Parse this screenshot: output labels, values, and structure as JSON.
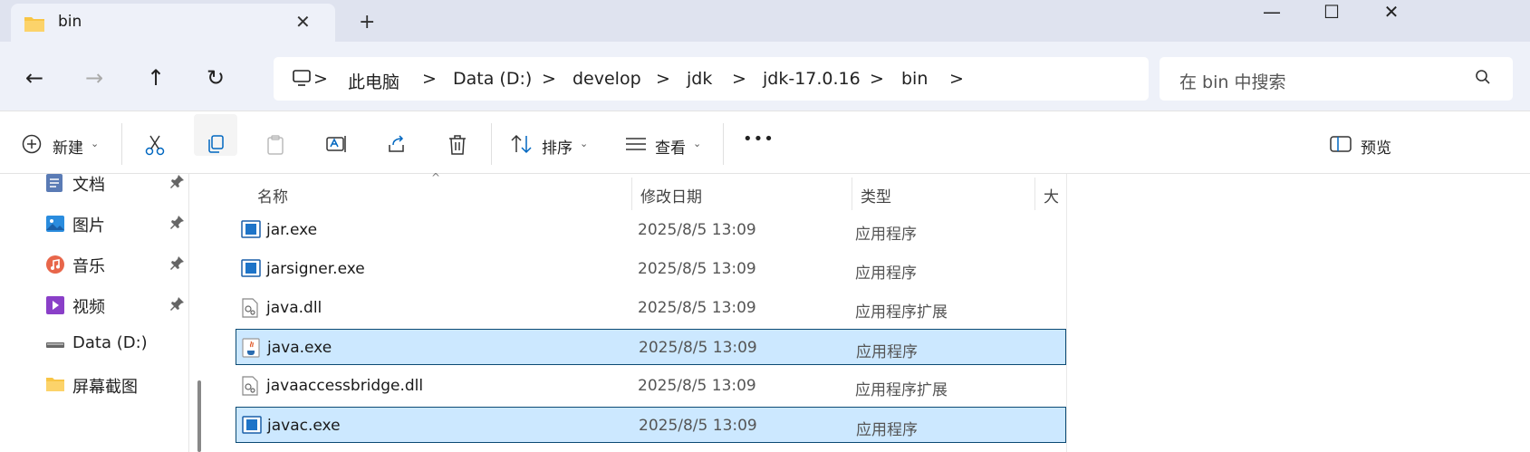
{
  "tab": {
    "title": "bin",
    "close_glyph": "✕",
    "new_tab_glyph": "+"
  },
  "window": {
    "minimize": "—",
    "maximize": "☐",
    "close": "✕"
  },
  "nav": {
    "back": "←",
    "forward": "→",
    "up": "↑",
    "refresh": "↻"
  },
  "breadcrumb": [
    "此电脑",
    "Data (D:)",
    "develop",
    "jdk",
    "jdk-17.0.16",
    "bin"
  ],
  "breadcrumb_sep": ">",
  "search": {
    "placeholder": "在 bin 中搜索"
  },
  "toolbar": {
    "new_label": "新建",
    "sort_label": "排序",
    "view_label": "查看",
    "more_label": "•••",
    "preview_label": "预览"
  },
  "sidebar": {
    "items": [
      {
        "label": "文档",
        "icon": "documents-icon",
        "pinned": true
      },
      {
        "label": "图片",
        "icon": "pictures-icon",
        "pinned": true
      },
      {
        "label": "音乐",
        "icon": "music-icon",
        "pinned": true
      },
      {
        "label": "视频",
        "icon": "videos-icon",
        "pinned": true
      },
      {
        "label": "Data (D:)",
        "icon": "drive-icon",
        "pinned": false
      },
      {
        "label": "屏幕截图",
        "icon": "folder-icon",
        "pinned": false
      }
    ]
  },
  "columns": {
    "name": "名称",
    "date": "修改日期",
    "type": "类型",
    "size": "大小"
  },
  "files": [
    {
      "name": "jar.exe",
      "date": "2025/8/5 13:09",
      "type": "应用程序",
      "icon": "exe-icon",
      "selected": false
    },
    {
      "name": "jarsigner.exe",
      "date": "2025/8/5 13:09",
      "type": "应用程序",
      "icon": "exe-icon",
      "selected": false
    },
    {
      "name": "java.dll",
      "date": "2025/8/5 13:09",
      "type": "应用程序扩展",
      "icon": "dll-icon",
      "selected": false
    },
    {
      "name": "java.exe",
      "date": "2025/8/5 13:09",
      "type": "应用程序",
      "icon": "java-icon",
      "selected": true
    },
    {
      "name": "javaaccessbridge.dll",
      "date": "2025/8/5 13:09",
      "type": "应用程序扩展",
      "icon": "dll-icon",
      "selected": false
    },
    {
      "name": "javac.exe",
      "date": "2025/8/5 13:09",
      "type": "应用程序",
      "icon": "exe-icon",
      "selected": true
    }
  ],
  "colors": {
    "accent": "#0067c0",
    "selection": "#cce8ff",
    "selection_border": "#0b4a74",
    "folder": "#f8c545"
  }
}
